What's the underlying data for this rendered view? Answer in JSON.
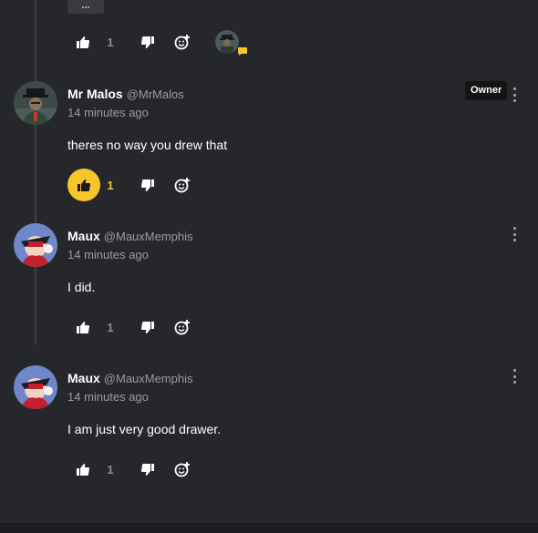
{
  "top_comment": {
    "more_label": "...",
    "likes": "1",
    "reactor_icon": "speech-bubble-icon",
    "accent": "#f7c52c"
  },
  "comments": [
    {
      "name": "Mr Malos",
      "handle": "@MrMalos",
      "time": "14 minutes ago",
      "text": "theres no way you drew that",
      "badge": "Owner",
      "likes": "1",
      "liked": true
    },
    {
      "name": "Maux",
      "handle": "@MauxMemphis",
      "time": "14 minutes ago",
      "text": "I did.",
      "likes": "1",
      "liked": false
    },
    {
      "name": "Maux",
      "handle": "@MauxMemphis",
      "time": "14 minutes ago",
      "text": "I am just very good drawer.",
      "likes": "1",
      "liked": false
    }
  ],
  "colors": {
    "background": "#26272b",
    "like_active": "#f7c52c",
    "muted": "#9a9ba1"
  }
}
